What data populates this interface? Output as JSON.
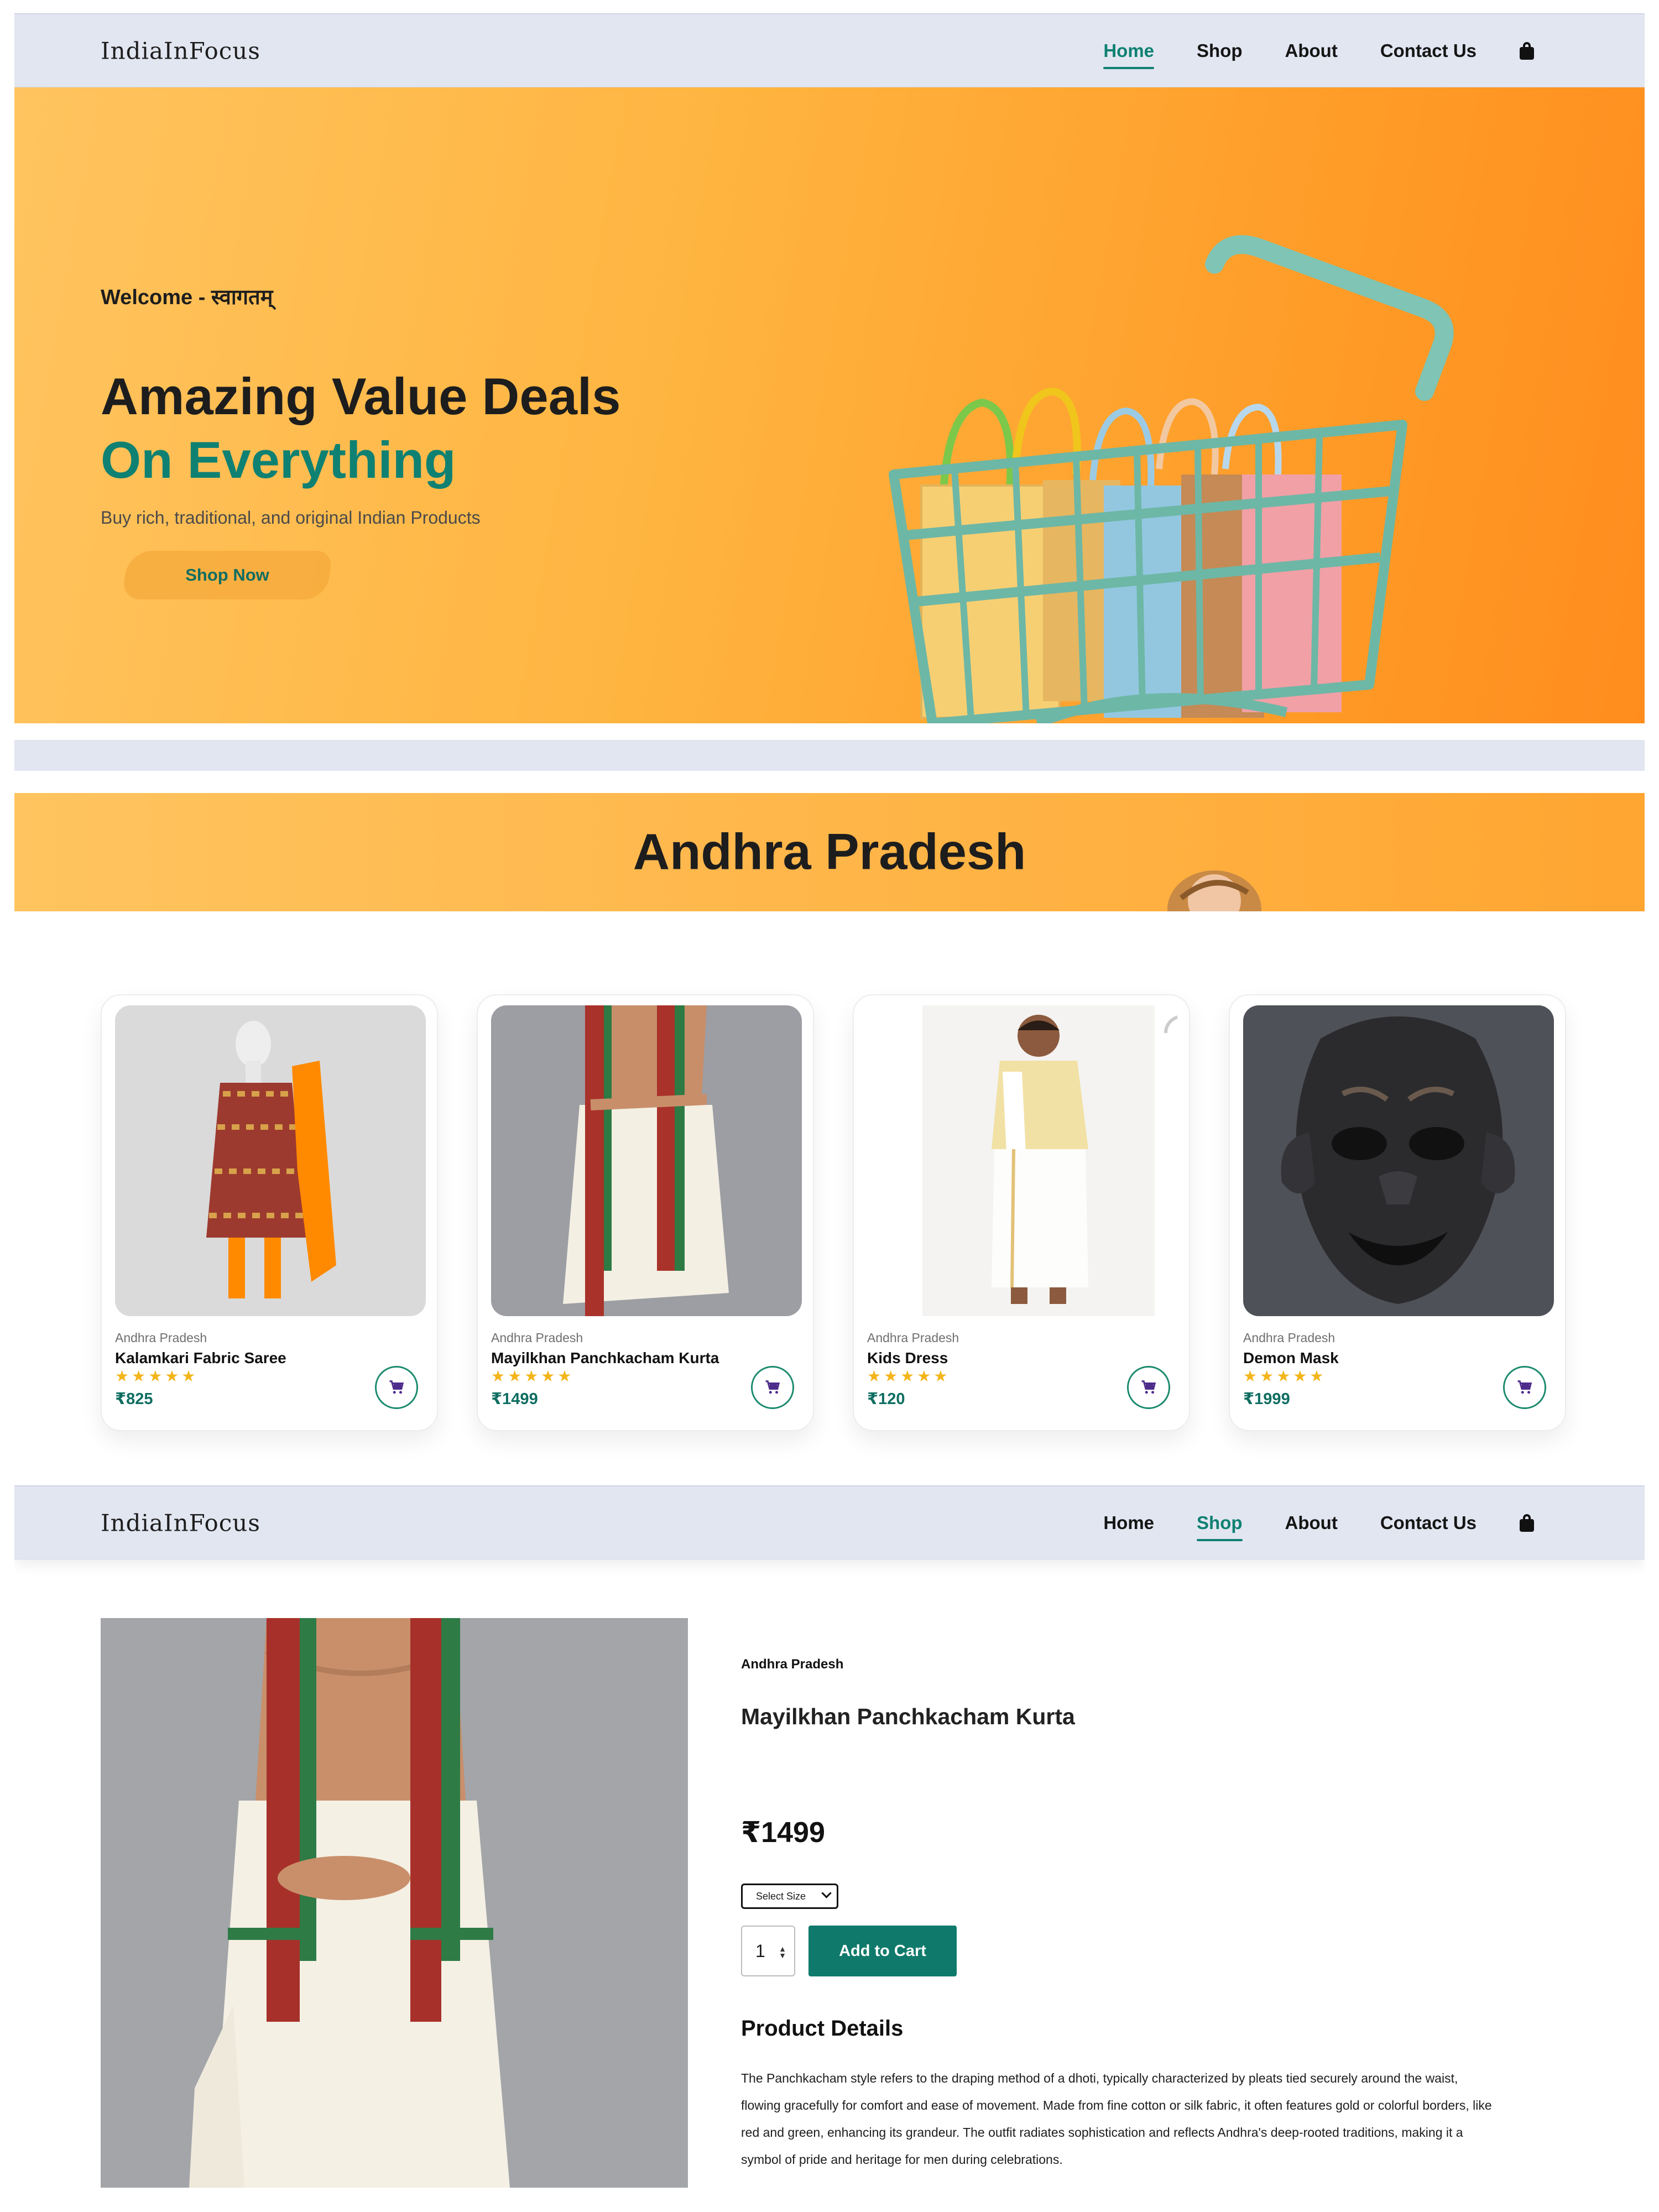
{
  "nav_top": {
    "logo": "IndiaInFocus",
    "links": [
      "Home",
      "Shop",
      "About",
      "Contact Us"
    ],
    "active": "Home",
    "cart_icon": "shopping-bag-icon"
  },
  "hero": {
    "welcome": "Welcome - स्वागतम्",
    "title_line1": "Amazing Value Deals",
    "title_line2": "On Everything",
    "subtitle": "Buy rich, traditional, and original Indian Products",
    "cta": "Shop Now",
    "image": "shopping-cart-with-bags-illustration"
  },
  "region_section": {
    "banner_title": "Andhra Pradesh",
    "products": [
      {
        "region": "Andhra Pradesh",
        "name": "Kalamkari Fabric Saree",
        "rating": 5,
        "stars": "★★★★★",
        "price": "₹825",
        "image": "saree-on-mannequin"
      },
      {
        "region": "Andhra Pradesh",
        "name": "Mayilkhan Panchkacham Kurta",
        "rating": 5,
        "stars": "★★★★★",
        "price": "₹1499",
        "image": "man-in-dhoti-with-stole"
      },
      {
        "region": "Andhra Pradesh",
        "name": "Kids Dress",
        "rating": 5,
        "stars": "★★★★★",
        "price": "₹120",
        "image": "boy-in-kurta-and-dhoti"
      },
      {
        "region": "Andhra Pradesh",
        "name": "Demon Mask",
        "rating": 5,
        "stars": "★★★★★",
        "price": "₹1999",
        "image": "dark-carved-demon-mask"
      }
    ],
    "add_icon": "cart-icon"
  },
  "nav_detail": {
    "logo": "IndiaInFocus",
    "links": [
      "Home",
      "Shop",
      "About",
      "Contact Us"
    ],
    "active": "Shop",
    "cart_icon": "shopping-bag-icon"
  },
  "product_detail": {
    "region": "Andhra Pradesh",
    "name": "Mayilkhan Panchkacham Kurta",
    "price": "₹1499",
    "size_select": {
      "selected": "Select Size"
    },
    "quantity": "1",
    "add_to_cart": "Add to Cart",
    "details_heading": "Product Details",
    "description": "The Panchkacham style refers to the draping method of a dhoti, typically characterized by pleats tied securely around the waist, flowing gracefully for comfort and ease of movement. Made from fine cotton or silk fabric, it often features gold or colorful borders, like red and green, enhancing its grandeur. The outfit radiates sophistication and reflects Andhra's deep-rooted traditions, making it a symbol of pride and heritage for men during celebrations."
  },
  "colors": {
    "accent": "#0f8172",
    "nav_bg": "#e2e6f1",
    "hero_orange": "#ffb541",
    "star": "#f3b51b"
  }
}
